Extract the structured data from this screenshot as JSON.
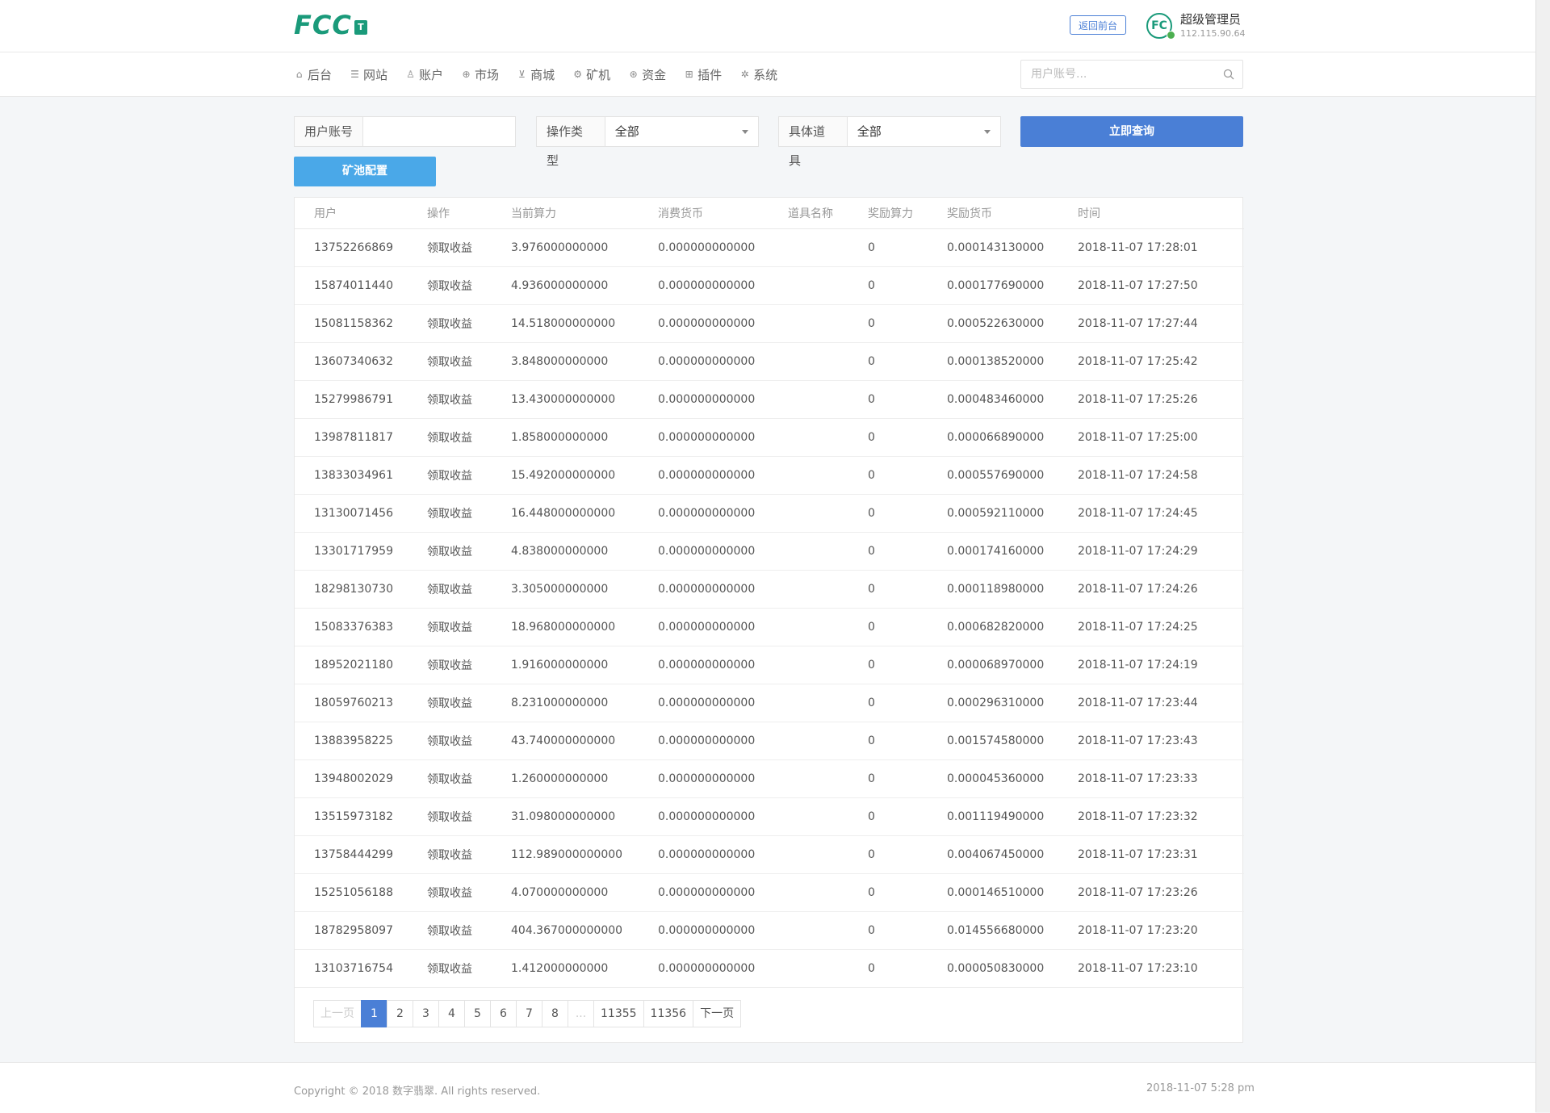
{
  "header": {
    "logo_text": "FCC",
    "logo_badge": "T",
    "front_button": "返回前台",
    "avatar_text": "FC",
    "admin_name": "超级管理员",
    "admin_ip": "112.115.90.64"
  },
  "nav": {
    "items": [
      {
        "label": "后台",
        "icon": "home-icon"
      },
      {
        "label": "网站",
        "icon": "list-icon"
      },
      {
        "label": "账户",
        "icon": "user-icon"
      },
      {
        "label": "市场",
        "icon": "globe-icon"
      },
      {
        "label": "商城",
        "icon": "cart-icon"
      },
      {
        "label": "矿机",
        "icon": "gear-icon"
      },
      {
        "label": "资金",
        "icon": "coin-icon"
      },
      {
        "label": "插件",
        "icon": "grid-icon"
      },
      {
        "label": "系统",
        "icon": "settings-icon"
      }
    ],
    "search_placeholder": "用户账号..."
  },
  "filters": {
    "user_label": "用户账号",
    "user_value": "",
    "op_type_label": "操作类型",
    "op_type_value": "全部",
    "item_label": "具体道具",
    "item_value": "全部",
    "query_button": "立即查询",
    "pool_button": "矿池配置"
  },
  "table": {
    "headers": [
      "用户",
      "操作",
      "当前算力",
      "消费货币",
      "道具名称",
      "奖励算力",
      "奖励货币",
      "时间"
    ],
    "rows": [
      [
        "13752266869",
        "领取收益",
        "3.976000000000",
        "0.000000000000",
        "",
        "0",
        "0.000143130000",
        "2018-11-07 17:28:01"
      ],
      [
        "15874011440",
        "领取收益",
        "4.936000000000",
        "0.000000000000",
        "",
        "0",
        "0.000177690000",
        "2018-11-07 17:27:50"
      ],
      [
        "15081158362",
        "领取收益",
        "14.518000000000",
        "0.000000000000",
        "",
        "0",
        "0.000522630000",
        "2018-11-07 17:27:44"
      ],
      [
        "13607340632",
        "领取收益",
        "3.848000000000",
        "0.000000000000",
        "",
        "0",
        "0.000138520000",
        "2018-11-07 17:25:42"
      ],
      [
        "15279986791",
        "领取收益",
        "13.430000000000",
        "0.000000000000",
        "",
        "0",
        "0.000483460000",
        "2018-11-07 17:25:26"
      ],
      [
        "13987811817",
        "领取收益",
        "1.858000000000",
        "0.000000000000",
        "",
        "0",
        "0.000066890000",
        "2018-11-07 17:25:00"
      ],
      [
        "13833034961",
        "领取收益",
        "15.492000000000",
        "0.000000000000",
        "",
        "0",
        "0.000557690000",
        "2018-11-07 17:24:58"
      ],
      [
        "13130071456",
        "领取收益",
        "16.448000000000",
        "0.000000000000",
        "",
        "0",
        "0.000592110000",
        "2018-11-07 17:24:45"
      ],
      [
        "13301717959",
        "领取收益",
        "4.838000000000",
        "0.000000000000",
        "",
        "0",
        "0.000174160000",
        "2018-11-07 17:24:29"
      ],
      [
        "18298130730",
        "领取收益",
        "3.305000000000",
        "0.000000000000",
        "",
        "0",
        "0.000118980000",
        "2018-11-07 17:24:26"
      ],
      [
        "15083376383",
        "领取收益",
        "18.968000000000",
        "0.000000000000",
        "",
        "0",
        "0.000682820000",
        "2018-11-07 17:24:25"
      ],
      [
        "18952021180",
        "领取收益",
        "1.916000000000",
        "0.000000000000",
        "",
        "0",
        "0.000068970000",
        "2018-11-07 17:24:19"
      ],
      [
        "18059760213",
        "领取收益",
        "8.231000000000",
        "0.000000000000",
        "",
        "0",
        "0.000296310000",
        "2018-11-07 17:23:44"
      ],
      [
        "13883958225",
        "领取收益",
        "43.740000000000",
        "0.000000000000",
        "",
        "0",
        "0.001574580000",
        "2018-11-07 17:23:43"
      ],
      [
        "13948002029",
        "领取收益",
        "1.260000000000",
        "0.000000000000",
        "",
        "0",
        "0.000045360000",
        "2018-11-07 17:23:33"
      ],
      [
        "13515973182",
        "领取收益",
        "31.098000000000",
        "0.000000000000",
        "",
        "0",
        "0.001119490000",
        "2018-11-07 17:23:32"
      ],
      [
        "13758444299",
        "领取收益",
        "112.989000000000",
        "0.000000000000",
        "",
        "0",
        "0.004067450000",
        "2018-11-07 17:23:31"
      ],
      [
        "15251056188",
        "领取收益",
        "4.070000000000",
        "0.000000000000",
        "",
        "0",
        "0.000146510000",
        "2018-11-07 17:23:26"
      ],
      [
        "18782958097",
        "领取收益",
        "404.367000000000",
        "0.000000000000",
        "",
        "0",
        "0.014556680000",
        "2018-11-07 17:23:20"
      ],
      [
        "13103716754",
        "领取收益",
        "1.412000000000",
        "0.000000000000",
        "",
        "0",
        "0.000050830000",
        "2018-11-07 17:23:10"
      ]
    ]
  },
  "pagination": {
    "prev": "上一页",
    "pages": [
      "1",
      "2",
      "3",
      "4",
      "5",
      "6",
      "7",
      "8",
      "...",
      "11355",
      "11356"
    ],
    "active": "1",
    "next": "下一页"
  },
  "footer": {
    "copyright": "Copyright © 2018 数字翡翠. All rights reserved.",
    "time": "2018-11-07 5:28 pm"
  },
  "colors": {
    "brand": "#1a9a7a",
    "primary": "#4a7fd6",
    "secondary": "#4aa8e8"
  }
}
